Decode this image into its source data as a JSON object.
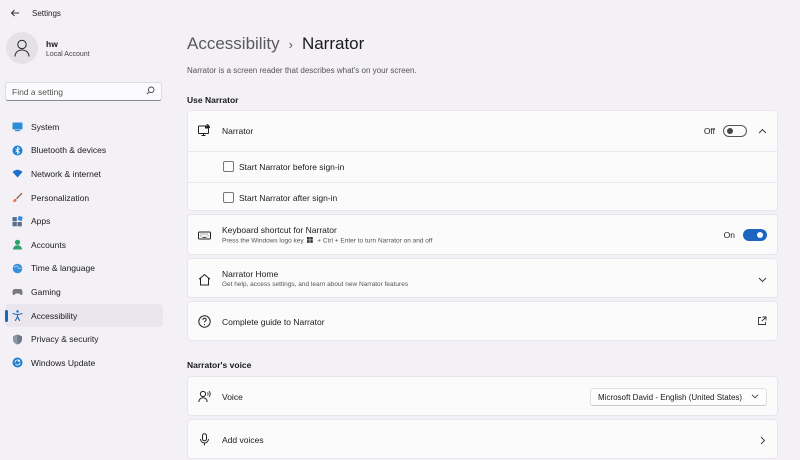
{
  "window": {
    "title": "Settings"
  },
  "profile": {
    "name": "hw",
    "account_type": "Local Account"
  },
  "search": {
    "placeholder": "Find a setting"
  },
  "sidebar": {
    "items": [
      {
        "label": "System",
        "icon": "system-icon"
      },
      {
        "label": "Bluetooth & devices",
        "icon": "bluetooth-icon"
      },
      {
        "label": "Network & internet",
        "icon": "wifi-icon"
      },
      {
        "label": "Personalization",
        "icon": "brush-icon"
      },
      {
        "label": "Apps",
        "icon": "apps-icon"
      },
      {
        "label": "Accounts",
        "icon": "person-icon"
      },
      {
        "label": "Time & language",
        "icon": "globe-icon"
      },
      {
        "label": "Gaming",
        "icon": "gamepad-icon"
      },
      {
        "label": "Accessibility",
        "icon": "accessibility-icon",
        "active": true
      },
      {
        "label": "Privacy & security",
        "icon": "shield-icon"
      },
      {
        "label": "Windows Update",
        "icon": "update-icon"
      }
    ]
  },
  "breadcrumb": {
    "parent": "Accessibility",
    "separator": "›",
    "current": "Narrator"
  },
  "description": "Narrator is a screen reader that describes what's on your screen.",
  "sections": {
    "use_narrator": "Use Narrator",
    "narrators_voice": "Narrator's voice"
  },
  "narrator": {
    "label": "Narrator",
    "state_label": "Off",
    "enabled": false,
    "options": [
      {
        "label": "Start Narrator before sign-in",
        "checked": false
      },
      {
        "label": "Start Narrator after sign-in",
        "checked": false
      }
    ]
  },
  "keyboard_shortcut": {
    "label": "Keyboard shortcut for Narrator",
    "sub_prefix": "Press the Windows logo key",
    "sub_suffix": "+ Ctrl + Enter to turn Narrator on and off",
    "state_label": "On",
    "enabled": true
  },
  "narrator_home": {
    "label": "Narrator Home",
    "sub": "Get help, access settings, and learn about new Narrator features"
  },
  "guide": {
    "label": "Complete guide to Narrator"
  },
  "voice": {
    "label": "Voice",
    "selected": "Microsoft David - English (United States)"
  },
  "add_voices": {
    "label": "Add voices"
  },
  "colors": {
    "accent": "#1a66c0",
    "background": "#f3f0f6",
    "card": "#fbfbfc"
  }
}
